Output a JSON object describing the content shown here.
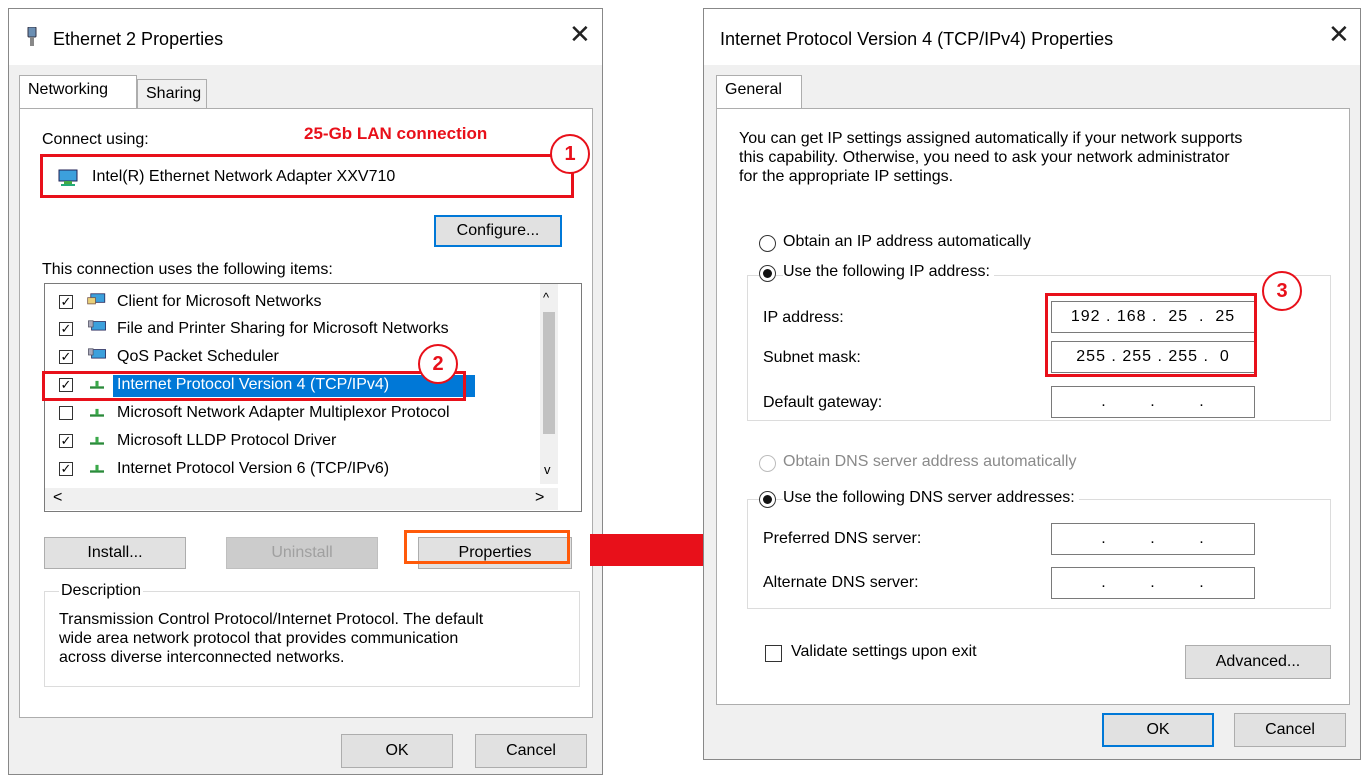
{
  "colors": {
    "annotation_red": "#e8101a",
    "accent_blue": "#0078d7",
    "dialog_bg": "#f0f0f0"
  },
  "left": {
    "title": "Ethernet 2 Properties",
    "close": "✕",
    "tabs": [
      "Networking",
      "Sharing"
    ],
    "connect_using_label": "Connect using:",
    "annotation_label": "25-Gb LAN connection",
    "adapter": "Intel(R) Ethernet Network Adapter XXV710",
    "configure_label": "Configure...",
    "items_label": "This connection uses the following items:",
    "items": [
      {
        "label": "Client for Microsoft Networks",
        "checked": true,
        "icon": "network-client-icon"
      },
      {
        "label": "File and Printer Sharing for Microsoft Networks",
        "checked": true,
        "icon": "network-service-icon"
      },
      {
        "label": "QoS Packet Scheduler",
        "checked": true,
        "icon": "network-service-icon"
      },
      {
        "label": "Internet Protocol Version 4 (TCP/IPv4)",
        "checked": true,
        "icon": "protocol-icon",
        "selected": true
      },
      {
        "label": "Microsoft Network Adapter Multiplexor Protocol",
        "checked": false,
        "icon": "protocol-icon"
      },
      {
        "label": "Microsoft LLDP Protocol Driver",
        "checked": true,
        "icon": "protocol-icon"
      },
      {
        "label": "Internet Protocol Version 6 (TCP/IPv6)",
        "checked": true,
        "icon": "protocol-icon"
      }
    ],
    "install_label": "Install...",
    "uninstall_label": "Uninstall",
    "properties_label": "Properties",
    "description_label": "Description",
    "description_lines": [
      "Transmission Control Protocol/Internet Protocol. The default",
      "wide area network protocol that provides communication",
      "across diverse interconnected networks."
    ],
    "ok_label": "OK",
    "cancel_label": "Cancel"
  },
  "right": {
    "title": "Internet Protocol Version 4 (TCP/IPv4) Properties",
    "close": "✕",
    "tab": "General",
    "info_lines": [
      "You can get IP settings assigned automatically if your network supports",
      "this capability. Otherwise, you need to ask your network administrator",
      "for the appropriate IP settings."
    ],
    "obtain_ip_auto": "Obtain an IP address automatically",
    "use_following_ip": "Use the following IP address:",
    "ip_address_label": "IP address:",
    "ip_address_value": "192 . 168 .  25  .  25",
    "subnet_label": "Subnet mask:",
    "subnet_value": "255 . 255 . 255 .  0",
    "gateway_label": "Default gateway:",
    "empty_ip": ".        .        .",
    "obtain_dns_auto": "Obtain DNS server address automatically",
    "use_following_dns": "Use the following DNS server addresses:",
    "preferred_dns_label": "Preferred DNS server:",
    "alternate_dns_label": "Alternate DNS server:",
    "validate_label": "Validate settings upon exit",
    "advanced_label": "Advanced...",
    "ok_label": "OK",
    "cancel_label": "Cancel"
  },
  "badges": {
    "one": "1",
    "two": "2",
    "three": "3"
  }
}
